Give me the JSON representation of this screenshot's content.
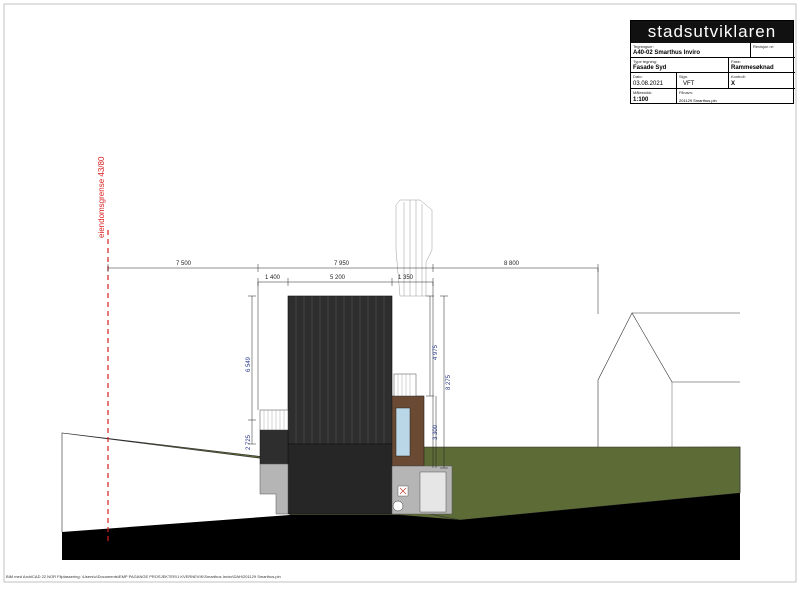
{
  "title_block": {
    "logo": "stadsutviklaren",
    "tegningsnr_label": "Tegningsnr:",
    "tegningsnr_value": "A40-02 Smarthus Inviro",
    "revisjon_label": "Revisjon nr:",
    "revisjon_value": "",
    "type_label": "Type tegning:",
    "type_value": "Fasade Syd",
    "fase_label": "Fase:",
    "fase_value": "Rammesøknad",
    "dato_label": "Dato:",
    "dato_value": "03.08.2021",
    "sign_label": "Sign.",
    "sign_value": "VFT",
    "kontroll_label": "Kontroll:",
    "kontroll_value": "X",
    "malestokk_label": "Målestokk:",
    "malestokk_value": "1:100",
    "filnavn_label": "Filnavn:",
    "filnavn_value": "201129 Smarthus.pln"
  },
  "drawing": {
    "property_line_label": "eiendomsgrense 43/80",
    "dimensions": {
      "top_left": "7 500",
      "top_middle": "7 950",
      "top_right": "8 800",
      "sub_left": "1 400",
      "sub_middle": "5 200",
      "sub_right": "1 350",
      "height_main": "6 549",
      "height_lower": "2 725",
      "height_tower": "4 975",
      "height_total": "8 275",
      "height_annex": "3 300"
    }
  },
  "footer": {
    "path_text": "BIM med ArchiCAD 22 NOR    Filplassering: \\Users\\c\\Documents\\EMP PAGANGE PROSJEKTER\\1 KVERNEVIK\\Smarthus Inviro\\DAH\\201129 Smarthus.pln"
  }
}
